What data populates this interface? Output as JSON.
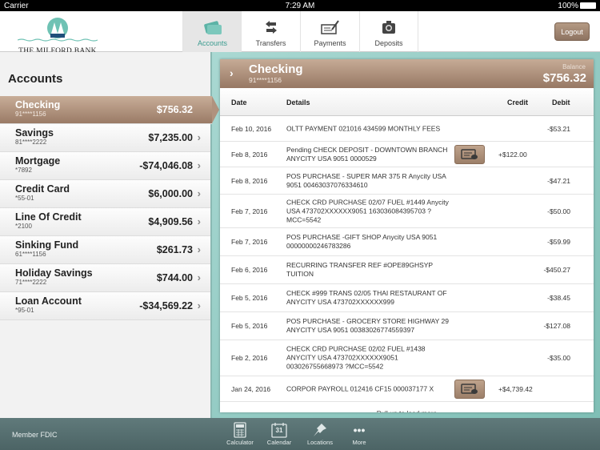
{
  "status_bar": {
    "carrier": "Carrier",
    "time": "7:29 AM",
    "battery": "100%"
  },
  "header": {
    "bank_name": "THE MILFORD BANK",
    "tabs": [
      {
        "label": "Accounts",
        "icon": "credit-card-icon",
        "selected": true
      },
      {
        "label": "Transfers",
        "icon": "transfer-arrows-icon"
      },
      {
        "label": "Payments",
        "icon": "check-pen-icon"
      },
      {
        "label": "Deposits",
        "icon": "camera-icon"
      }
    ],
    "logout_label": "Logout"
  },
  "sidebar": {
    "title": "Accounts",
    "accounts": [
      {
        "name": "Checking",
        "number": "91****1156",
        "balance": "$756.32",
        "selected": true
      },
      {
        "name": "Savings",
        "number": "81****2222",
        "balance": "$7,235.00"
      },
      {
        "name": "Mortgage",
        "number": "*7892",
        "balance": "-$74,046.08"
      },
      {
        "name": "Credit Card",
        "number": "*55-01",
        "balance": "$6,000.00"
      },
      {
        "name": "Line Of Credit",
        "number": "*2100",
        "balance": "$4,909.56"
      },
      {
        "name": "Sinking Fund",
        "number": "61****1156",
        "balance": "$261.73"
      },
      {
        "name": "Holiday Savings",
        "number": "71****2222",
        "balance": "$744.00"
      },
      {
        "name": "Loan Account",
        "number": "*95-01",
        "balance": "-$34,569.22"
      }
    ]
  },
  "detail": {
    "account_name": "Checking",
    "account_number": "91****1156",
    "balance_label": "Balance",
    "balance": "$756.32",
    "columns": {
      "date": "Date",
      "details": "Details",
      "credit": "Credit",
      "debit": "Debit"
    },
    "transactions": [
      {
        "date": "Feb 10, 2016",
        "details": "OLTT PAYMENT 021016 434599 MONTHLY FEES",
        "credit": "",
        "debit": "-$53.21"
      },
      {
        "date": "Feb 8, 2016",
        "details": "Pending CHECK DEPOSIT - DOWNTOWN BRANCH ANYCITY USA 9051 0000529",
        "credit": "+$122.00",
        "debit": "",
        "check_image": true
      },
      {
        "date": "Feb 8, 2016",
        "details": "POS PURCHASE -  SUPER MAR 375 R Anycity USA 9051 00463037076334610",
        "credit": "",
        "debit": "-$47.21"
      },
      {
        "date": "Feb 7, 2016",
        "details": "CHECK CRD PURCHASE 02/07  FUEL #1449 Anycity USA 473702XXXXXX9051 163036084395703 ?MCC=5542",
        "credit": "",
        "debit": "-$50.00"
      },
      {
        "date": "Feb 7, 2016",
        "details": "POS PURCHASE -GIFT SHOP Anycity USA 9051 00000000246783286",
        "credit": "",
        "debit": "-$59.99"
      },
      {
        "date": "Feb 6, 2016",
        "details": "RECURRING TRANSFER REF #OPE89GHSYP TUITION",
        "credit": "",
        "debit": "-$450.27"
      },
      {
        "date": "Feb 5, 2016",
        "details": "CHECK #999 TRANS 02/05 THAI RESTAURANT OF ANYCITY USA 473702XXXXXX999",
        "credit": "",
        "debit": "-$38.45"
      },
      {
        "date": "Feb 5, 2016",
        "details": "POS PURCHASE - GROCERY STORE HIGHWAY 29 ANYCITY USA 9051 00383026774559397",
        "credit": "",
        "debit": "-$127.08"
      },
      {
        "date": "Feb 2, 2016",
        "details": "CHECK CRD PURCHASE 02/02 FUEL #1438 ANYCITY USA 473702XXXXXX9051 003026755668973 ?MCC=5542",
        "credit": "",
        "debit": "-$35.00"
      },
      {
        "date": "Jan 24, 2016",
        "details": "CORPOR PAYROLL 012416 CF15 000037177 X",
        "credit": "+$4,739.42",
        "debit": "",
        "check_image": true
      }
    ],
    "load_more": "Pull up to load more"
  },
  "footer": {
    "member": "Member FDIC",
    "calendar_day": "31",
    "tools": [
      {
        "label": "Calculator",
        "icon": "calculator-icon"
      },
      {
        "label": "Calendar",
        "icon": "calendar-icon"
      },
      {
        "label": "Locations",
        "icon": "pushpin-icon"
      },
      {
        "label": "More",
        "icon": "more-dots-icon"
      }
    ]
  }
}
